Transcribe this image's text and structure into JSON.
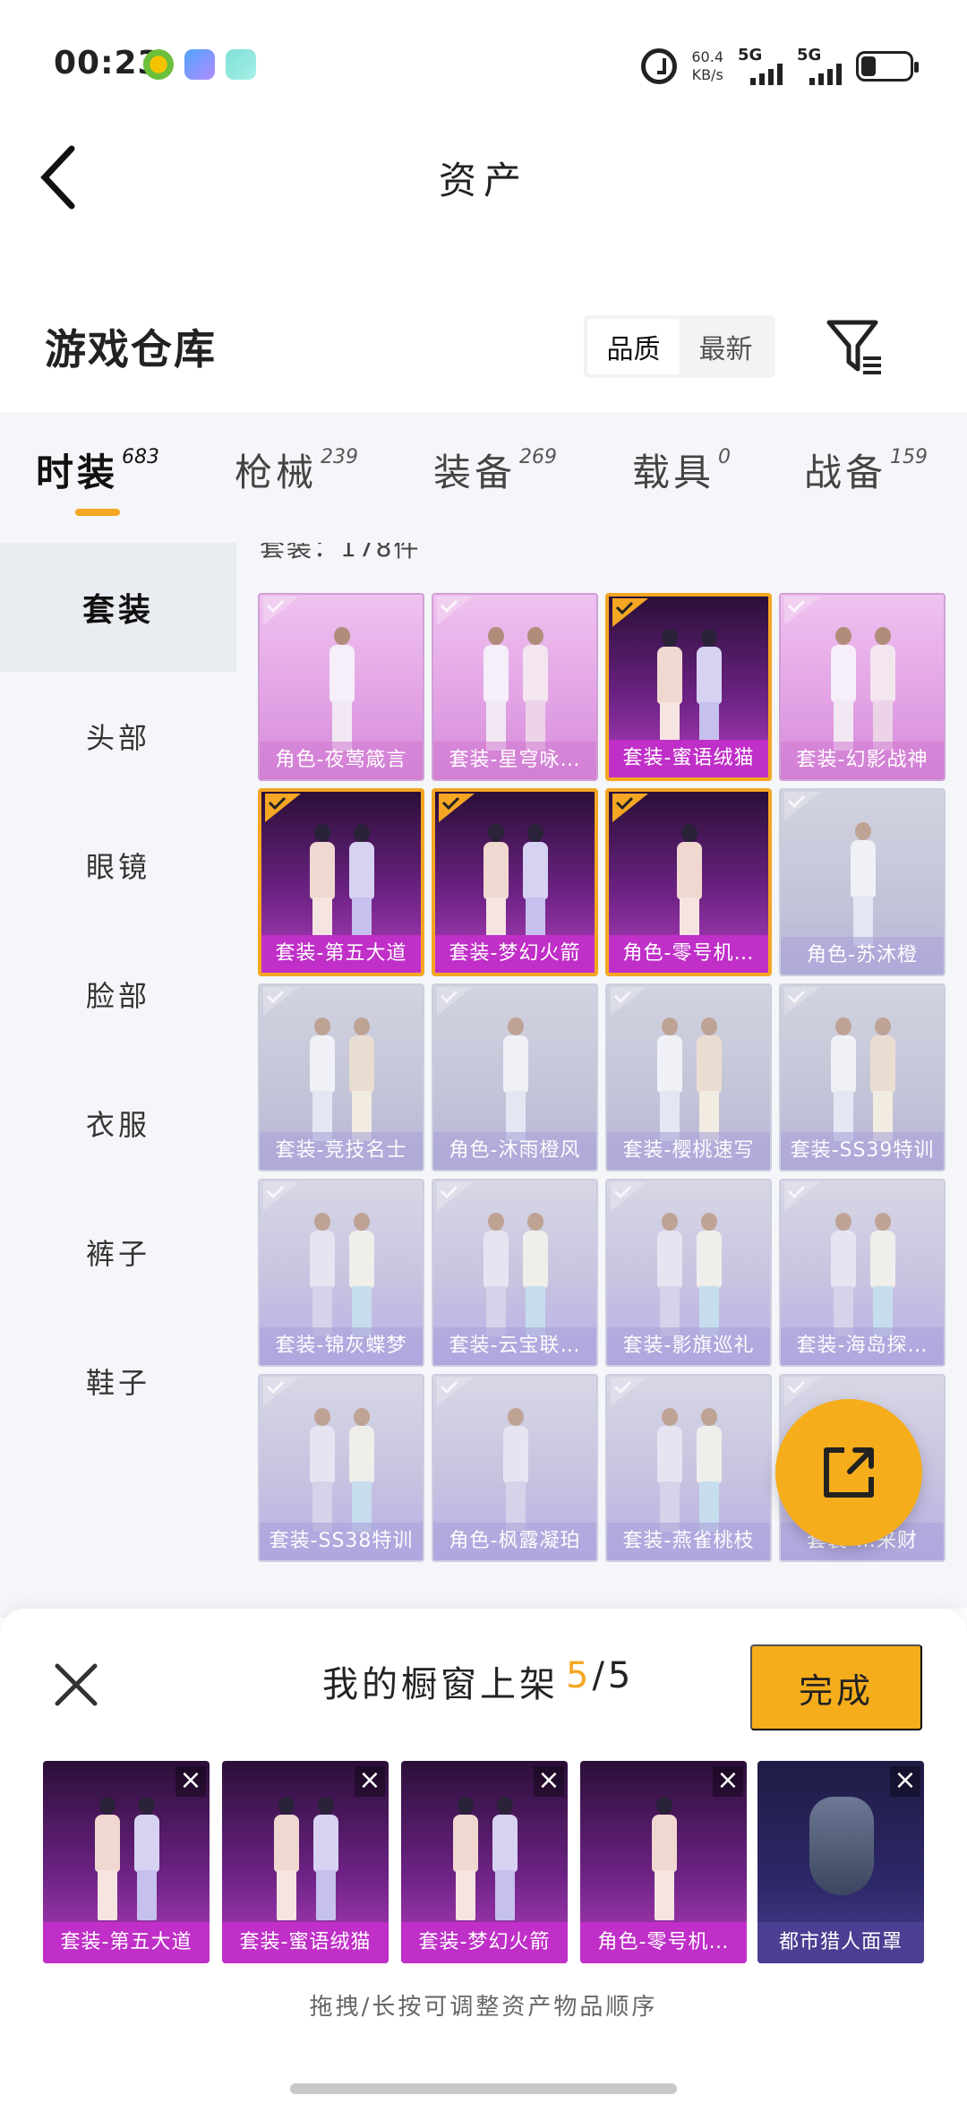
{
  "status_bar": {
    "time": "00:23",
    "net_speed_value": "60.4",
    "net_speed_unit": "KB/s",
    "signal1": "5G",
    "signal2": "5G"
  },
  "header": {
    "title": "资产"
  },
  "warehouse": {
    "title": "游戏仓库",
    "sort_options": [
      "品质",
      "最新"
    ],
    "sort_active": "品质"
  },
  "tabs": [
    {
      "label": "时装",
      "count": "683",
      "active": true
    },
    {
      "label": "枪械",
      "count": "239",
      "active": false
    },
    {
      "label": "装备",
      "count": "269",
      "active": false
    },
    {
      "label": "载具",
      "count": "0",
      "active": false
    },
    {
      "label": "战备",
      "count": "159",
      "active": false
    }
  ],
  "sidebar": {
    "items": [
      {
        "label": "套装",
        "active": true
      },
      {
        "label": "头部"
      },
      {
        "label": "眼镜"
      },
      {
        "label": "脸部"
      },
      {
        "label": "衣服"
      },
      {
        "label": "裤子"
      },
      {
        "label": "鞋子"
      }
    ]
  },
  "grid": {
    "suit_count": "套装：178件",
    "items": [
      {
        "name": "角色-夜莺箴言",
        "style": "pink",
        "selected": false
      },
      {
        "name": "套装-星穹咏…",
        "style": "pink",
        "selected": false
      },
      {
        "name": "套装-蜜语绒猫",
        "style": "dark",
        "selected": true
      },
      {
        "name": "套装-幻影战神",
        "style": "pink",
        "selected": false
      },
      {
        "name": "套装-第五大道",
        "style": "dark",
        "selected": true
      },
      {
        "name": "套装-梦幻火箭",
        "style": "dark",
        "selected": true
      },
      {
        "name": "角色-零号机…",
        "style": "dark",
        "selected": true
      },
      {
        "name": "角色-苏沐橙",
        "style": "gray",
        "selected": false
      },
      {
        "name": "套装-竞技名士",
        "style": "gray",
        "selected": false
      },
      {
        "name": "角色-沐雨橙风",
        "style": "gray",
        "selected": false
      },
      {
        "name": "套装-樱桃速写",
        "style": "gray",
        "selected": false
      },
      {
        "name": "套装-SS39特训",
        "style": "gray",
        "selected": false
      },
      {
        "name": "套装-锦灰蝶梦",
        "style": "purple",
        "selected": false
      },
      {
        "name": "套装-云宝联…",
        "style": "purple",
        "selected": false
      },
      {
        "name": "套装-影旗巡礼",
        "style": "purple",
        "selected": false
      },
      {
        "name": "套装-海岛探…",
        "style": "purple",
        "selected": false
      },
      {
        "name": "套装-SS38特训",
        "style": "purple",
        "selected": false
      },
      {
        "name": "角色-枫露凝珀",
        "style": "purple",
        "selected": false
      },
      {
        "name": "套装-燕雀桃枝",
        "style": "purple",
        "selected": false
      },
      {
        "name": "套装-…来财",
        "style": "purple",
        "selected": false
      }
    ]
  },
  "fab": {
    "icon": "share-icon"
  },
  "showcase": {
    "title": "我的橱窗上架",
    "count_current": "5",
    "count_total": "/5",
    "done_label": "完成",
    "items": [
      {
        "name": "套装-第五大道"
      },
      {
        "name": "套装-蜜语绒猫"
      },
      {
        "name": "套装-梦幻火箭"
      },
      {
        "name": "角色-零号机…"
      },
      {
        "name": "都市猎人面罩"
      }
    ],
    "hint": "拖拽/长按可调整资产物品顺序"
  },
  "colors": {
    "accent": "#f6ad1b",
    "selected_card": "#c02fc8"
  }
}
